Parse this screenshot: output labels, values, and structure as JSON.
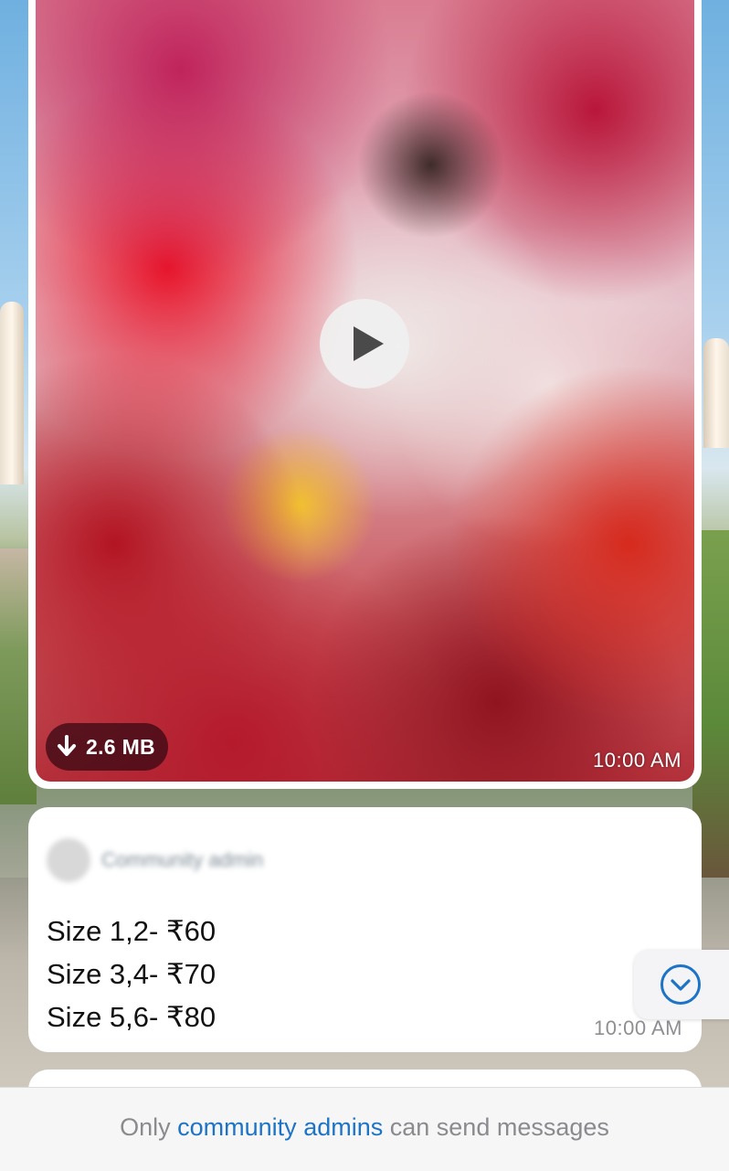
{
  "video_message": {
    "file_size": "2.6 MB",
    "time": "10:00 AM",
    "icons": {
      "play": "play-icon",
      "download": "download-arrow-icon"
    }
  },
  "text_message": {
    "sender": "Community admin",
    "lines": [
      "Size 1,2- ₹60",
      "Size 3,4- ₹70",
      "Size 5,6- ₹80"
    ],
    "time": "10:00 AM"
  },
  "scroll_down": {
    "icon": "chevron-down-circle-icon"
  },
  "footer": {
    "prefix": "Only",
    "link": "community admins",
    "suffix": "can send messages"
  },
  "colors": {
    "accent": "#1d73c6",
    "bubble": "#ffffff",
    "footer_bg": "#f6f6f6"
  }
}
